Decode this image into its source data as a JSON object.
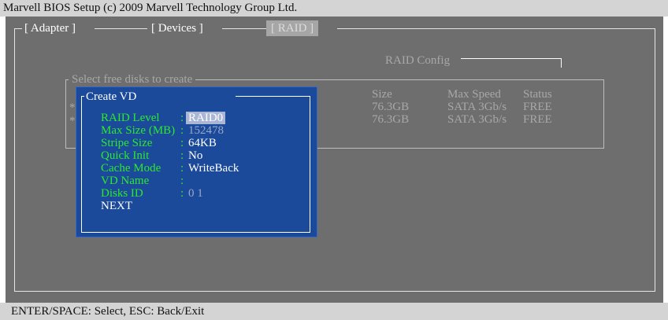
{
  "window": {
    "title": "Marvell BIOS Setup (c) 2009 Marvell Technology Group Ltd.",
    "footer_help": "ENTER/SPACE: Select, ESC: Back/Exit"
  },
  "tabs": [
    {
      "label": "[ Adapter ]",
      "active": false
    },
    {
      "label": "[ Devices ]",
      "active": false
    },
    {
      "label": "[  RAID  ]",
      "active": true
    }
  ],
  "raid_config": {
    "label": "RAID Config"
  },
  "disks_panel": {
    "legend": "Select free disks to create",
    "columns": [
      "Size",
      "Max Speed",
      "Status"
    ],
    "rows": [
      {
        "marker": "*",
        "size": "76.3GB",
        "speed": "SATA 3Gb/s",
        "status": "FREE"
      },
      {
        "marker": "*",
        "size": "76.3GB",
        "speed": "SATA 3Gb/s",
        "status": "FREE"
      }
    ]
  },
  "create_vd": {
    "title": "Create VD",
    "fields": [
      {
        "label": "RAID Level",
        "colon": ":",
        "value": "RAID0"
      },
      {
        "label": "Max Size (MB)",
        "colon": ":",
        "value": "152478"
      },
      {
        "label": "Stripe Size",
        "colon": ":",
        "value": "64KB"
      },
      {
        "label": "Quick Init",
        "colon": ":",
        "value": "No"
      },
      {
        "label": "Cache Mode",
        "colon": ":",
        "value": "WriteBack"
      },
      {
        "label": "VD Name",
        "colon": ":",
        "value": ""
      },
      {
        "label": "Disks ID",
        "colon": ":",
        "value": "0  1"
      }
    ],
    "next_label": "NEXT"
  },
  "colors": {
    "background": "#6e6e6e",
    "dialog": "#1b4a9a",
    "label_green": "#2ee82e",
    "bar": "#d4d4d4"
  }
}
